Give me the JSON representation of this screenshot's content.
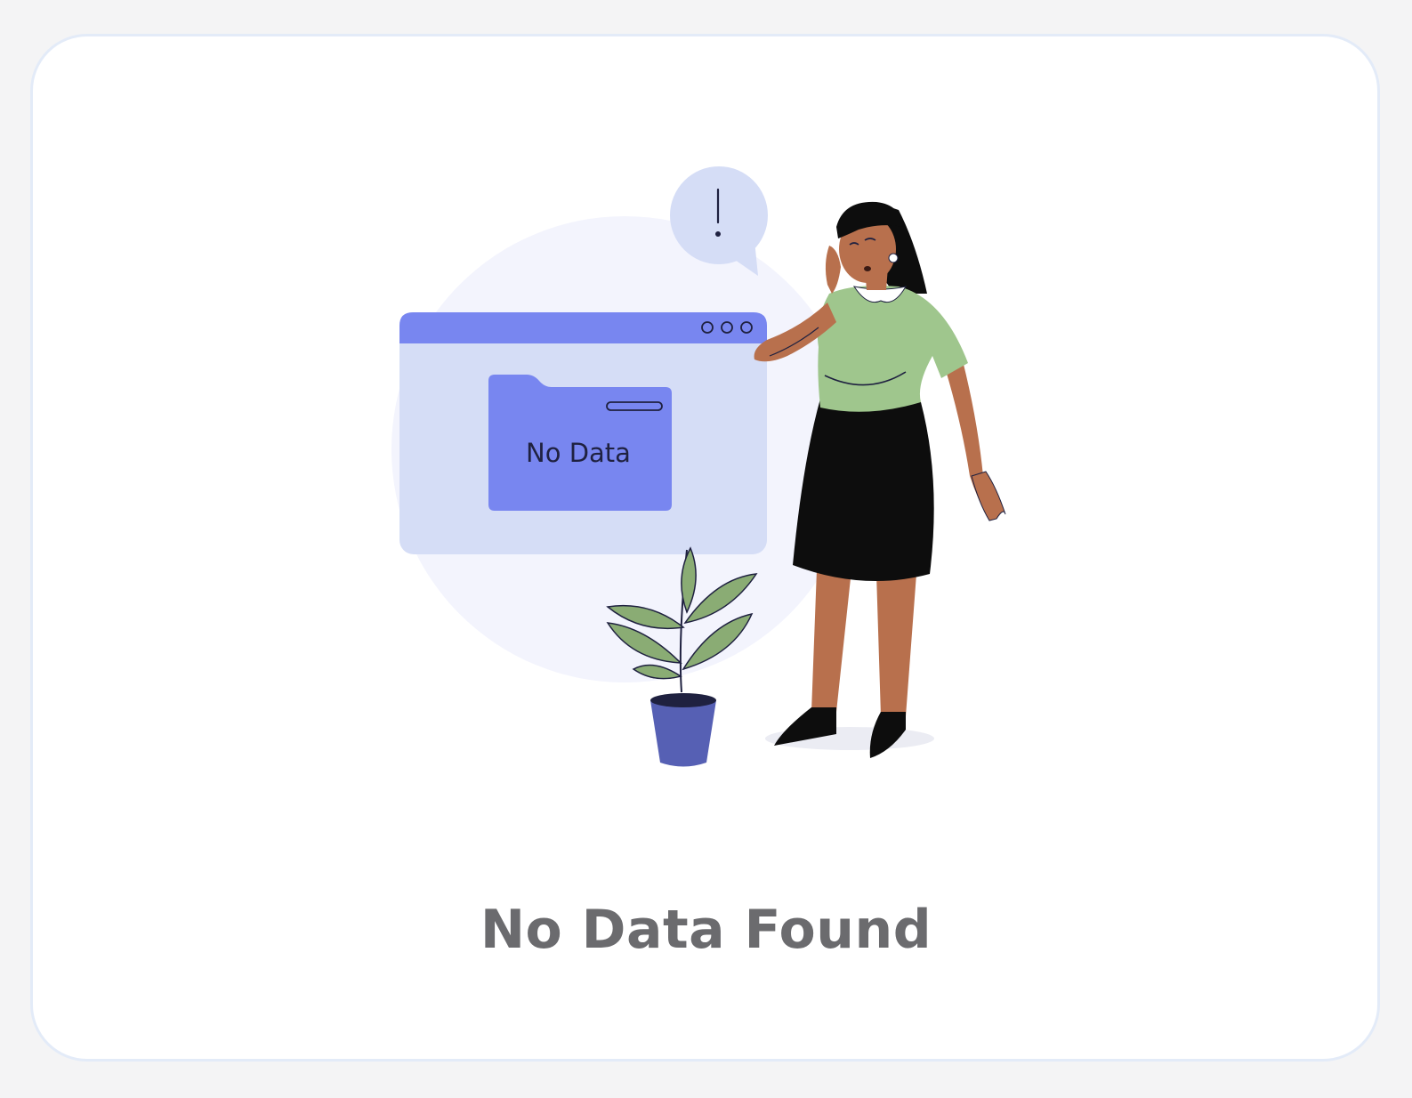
{
  "empty_state": {
    "title": "No Data Found",
    "folder_label": "No Data",
    "alert_symbol": "!",
    "icons": [
      "no-data-illustration",
      "exclamation-icon",
      "window-dots-icon",
      "folder-icon",
      "plant-icon",
      "person-illustration"
    ]
  },
  "colors": {
    "accent": "#7886f0",
    "window_body": "#d5ddf6",
    "background_blob": "#f3f4fd",
    "title_text": "#6b6b6e",
    "card_border": "#e3ebf8"
  }
}
